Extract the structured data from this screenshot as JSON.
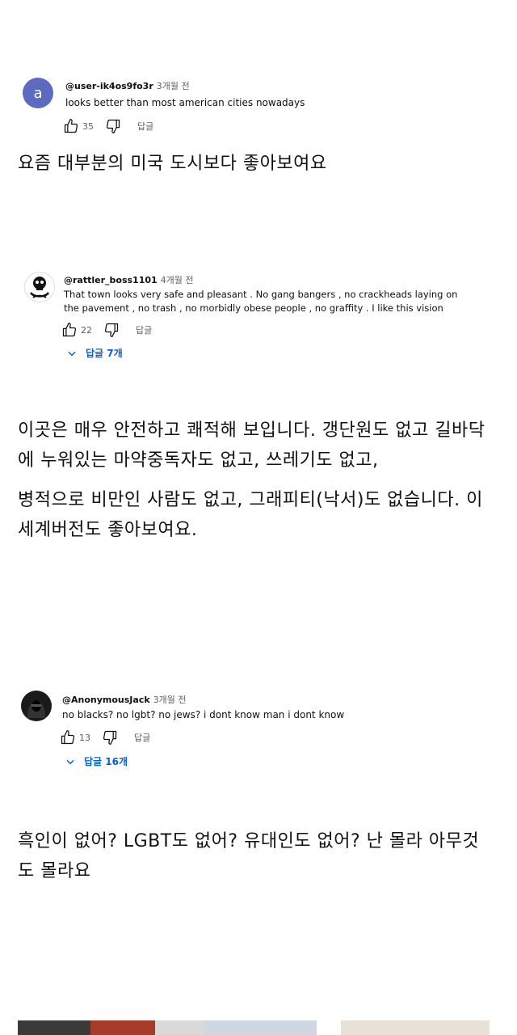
{
  "comments": [
    {
      "avatar_letter": "a",
      "avatar_color": "#5c6bc0",
      "handle": "@user-ik4os9fo3r",
      "time": "3개월 전",
      "text": "looks better than most american cities nowadays",
      "likes": "35",
      "reply_label": "답글",
      "translation": [
        "요즘 대부분의 미국 도시보다 좋아보여요"
      ]
    },
    {
      "avatar_icon": "skull-icon",
      "handle": "@rattler_boss1101",
      "time": "4개월 전",
      "text": "That town looks very safe and pleasant . No gang bangers , no crackheads laying on the pavement , no trash , no morbidly obese people , no graffity . I like this vision",
      "likes": "22",
      "reply_label": "답글",
      "replies_label": "답글 7개",
      "translation": [
        "이곳은 매우 안전하고 쾌적해 보입니다. 갱단원도 없고 길바닥에 누워있는 마약중독자도 없고, 쓰레기도 없고,",
        "병적으로 비만인 사람도 없고, 그래피티(낙서)도 없습니다. 이 세계버전도 좋아보여요."
      ]
    },
    {
      "avatar_icon": "hooded-figure-icon",
      "handle": "@AnonymousJack",
      "time": "3개월 전",
      "text": "no blacks? no lgbt? no jews? i dont know man i dont know",
      "likes": "13",
      "reply_label": "답글",
      "replies_label": "답글 16개",
      "translation": [
        "흑인이 없어? LGBT도 없어? 유대인도 없어? 난 몰라 아무것도 몰라요"
      ]
    }
  ],
  "colors": {
    "link_blue": "#065fd4",
    "meta_gray": "#606060"
  }
}
